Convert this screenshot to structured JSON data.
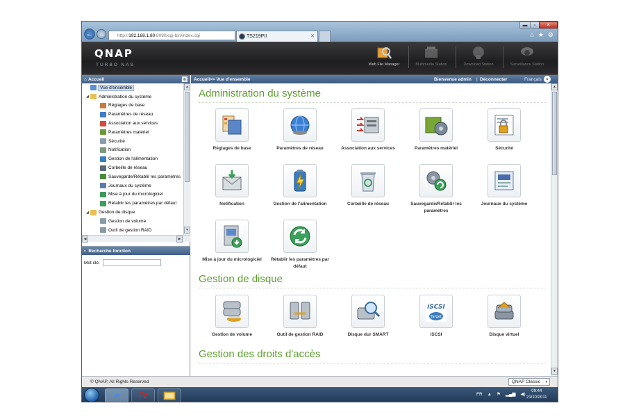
{
  "browser": {
    "address_prefix": "http://",
    "address_host": "192.168.1.80",
    "address_rest": ":8080/cgi-bin/index.cgi",
    "address_icons": "ρ ▾ ⊠ C ✕",
    "tabs": [
      {
        "label": "TS219PII"
      },
      {
        "label": ""
      }
    ],
    "window_controls": {
      "min": "▬",
      "max": "▫",
      "close": "✕"
    },
    "toolbar_icons": {
      "home": "⌂",
      "favorites": "★",
      "settings": "⚙"
    }
  },
  "header": {
    "logo": "QNAP",
    "logo_sub": "TURBO NAS",
    "stations": [
      {
        "label": "Web File Manager",
        "icon": "web-file-manager-icon",
        "active": true
      },
      {
        "label": "Multimedia Station",
        "icon": "multimedia-station-icon",
        "active": false
      },
      {
        "label": "Download Station",
        "icon": "download-station-icon",
        "active": false
      },
      {
        "label": "Surveillance Station",
        "icon": "surveillance-station-icon",
        "active": false
      }
    ]
  },
  "sidebar": {
    "title": "Accueil",
    "collapse": "«",
    "tree": [
      {
        "label": "Vue d'ensemble",
        "level": 0,
        "icon": "overview-icon",
        "color": "#5a8fd0",
        "selected": true
      },
      {
        "label": "Administration du système",
        "level": 0,
        "icon": "folder-icon",
        "color": "#e8c154",
        "expand": "◢"
      },
      {
        "label": "Réglages de base",
        "level": 1,
        "icon": "basic-settings-icon",
        "color": "#c77a3c"
      },
      {
        "label": "Paramètres de réseau",
        "level": 1,
        "icon": "network-icon",
        "color": "#3d7cc9"
      },
      {
        "label": "Association aux services",
        "level": 1,
        "icon": "services-icon",
        "color": "#d24b3e"
      },
      {
        "label": "Paramètres matériel",
        "level": 1,
        "icon": "hardware-icon",
        "color": "#6a9a38"
      },
      {
        "label": "Sécurité",
        "level": 1,
        "icon": "security-icon",
        "color": "#8a9cb0"
      },
      {
        "label": "Notification",
        "level": 1,
        "icon": "notification-icon",
        "color": "#7a9a7a"
      },
      {
        "label": "Gestion de l'alimentation",
        "level": 1,
        "icon": "power-icon",
        "color": "#3a7cc0"
      },
      {
        "label": "Corbeille de réseau",
        "level": 1,
        "icon": "recycle-bin-icon",
        "color": "#5a6a7a"
      },
      {
        "label": "Sauvegarde/Rétablir les paramètres",
        "level": 1,
        "icon": "backup-icon",
        "color": "#4a8a3a"
      },
      {
        "label": "Journaux du système",
        "level": 1,
        "icon": "logs-icon",
        "color": "#5a7ab0"
      },
      {
        "label": "Mise à jour du micrologiciel",
        "level": 1,
        "icon": "firmware-icon",
        "color": "#3a9a5a"
      },
      {
        "label": "Rétablir les paramètres par défaut",
        "level": 1,
        "icon": "restore-icon",
        "color": "#3aa05a"
      },
      {
        "label": "Gestion de disque",
        "level": 0,
        "icon": "folder-icon",
        "color": "#e8c154",
        "expand": "◢"
      },
      {
        "label": "Gestion de volume",
        "level": 1,
        "icon": "volume-icon",
        "color": "#8a9aa8"
      },
      {
        "label": "Outil de gestion RAID",
        "level": 1,
        "icon": "raid-icon",
        "color": "#8a9aa8"
      }
    ],
    "search": {
      "title": "Recherche fonction",
      "label": "Mot clé:",
      "value": ""
    }
  },
  "topbar": {
    "breadcrumb": "Accueil>> Vue d'ensemble",
    "welcome": "Bienvenue admin",
    "separator": "|",
    "logout": "Déconnecter",
    "language": "Français",
    "language_arrow": "▾"
  },
  "sections": [
    {
      "title": "Administration du système",
      "items": [
        {
          "label": "Réglages de base",
          "icon": "basic-settings-icon"
        },
        {
          "label": "Paramètres de réseau",
          "icon": "network-globe-icon"
        },
        {
          "label": "Association aux services",
          "icon": "services-server-icon"
        },
        {
          "label": "Paramètres matériel",
          "icon": "hardware-gear-icon"
        },
        {
          "label": "Sécurité",
          "icon": "security-lock-icon"
        },
        {
          "label": "Notification",
          "icon": "notification-mail-icon"
        },
        {
          "label": "Gestion de l'alimentation",
          "icon": "power-battery-icon"
        },
        {
          "label": "Corbeille de réseau",
          "icon": "recycle-bin-icon"
        },
        {
          "label": "Sauvegarde/Rétablir les paramètres",
          "icon": "backup-gears-icon"
        },
        {
          "label": "Journaux du système",
          "icon": "system-logs-icon"
        },
        {
          "label": "Mise à jour du micrologiciel",
          "icon": "firmware-update-icon"
        },
        {
          "label": "Rétablir les paramètres par défaut",
          "icon": "restore-defaults-icon"
        }
      ]
    },
    {
      "title": "Gestion de disque",
      "items": [
        {
          "label": "Gestion de volume",
          "icon": "volume-management-icon"
        },
        {
          "label": "Outil de gestion RAID",
          "icon": "raid-tool-icon"
        },
        {
          "label": "Disque dur SMART",
          "icon": "smart-disk-icon"
        },
        {
          "label": "iSCSI",
          "icon": "iscsi-icon",
          "icon_text": "iSCSI",
          "icon_subtext": "Target"
        },
        {
          "label": "Disque virtuel",
          "icon": "virtual-disk-icon"
        }
      ]
    },
    {
      "title": "Gestion des droits d'accès",
      "items": []
    }
  ],
  "statusbar": {
    "copyright": "© QNAP, All Rights Reserved",
    "theme": "QNAP Classic",
    "theme_arrow": "▾"
  },
  "taskbar": {
    "apps": [
      {
        "label": "e",
        "icon": "internet-explorer-icon"
      },
      {
        "label": "Fz",
        "icon": "filezilla-icon"
      },
      {
        "label": "",
        "icon": "file-explorer-icon"
      }
    ],
    "tray": {
      "lang": "FR",
      "up": "▲",
      "flag": "⚑",
      "signal": "▂▄▆",
      "volume": "◀)"
    },
    "time": "09:44",
    "date": "21/10/2011"
  },
  "colors": {
    "section_title": "#5c9e2e",
    "bar": "#3f5f86",
    "selected": "#cfe0f5"
  }
}
